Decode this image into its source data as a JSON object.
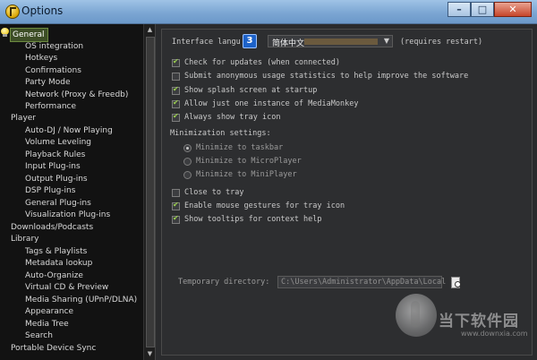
{
  "window": {
    "title": "Options",
    "minimize_label": "–",
    "maximize_label": "□",
    "close_label": "✕"
  },
  "tree": {
    "items": [
      {
        "label": "General",
        "level": 0,
        "selected": true
      },
      {
        "label": "OS integration",
        "level": 1
      },
      {
        "label": "Hotkeys",
        "level": 1
      },
      {
        "label": "Confirmations",
        "level": 1
      },
      {
        "label": "Party Mode",
        "level": 1
      },
      {
        "label": "Network (Proxy & Freedb)",
        "level": 1
      },
      {
        "label": "Performance",
        "level": 1
      },
      {
        "label": "Player",
        "level": 0
      },
      {
        "label": "Auto-DJ / Now Playing",
        "level": 1
      },
      {
        "label": "Volume Leveling",
        "level": 1
      },
      {
        "label": "Playback Rules",
        "level": 1
      },
      {
        "label": "Input Plug-ins",
        "level": 1
      },
      {
        "label": "Output Plug-ins",
        "level": 1
      },
      {
        "label": "DSP Plug-ins",
        "level": 1
      },
      {
        "label": "General Plug-ins",
        "level": 1
      },
      {
        "label": "Visualization Plug-ins",
        "level": 1
      },
      {
        "label": "Downloads/Podcasts",
        "level": 0
      },
      {
        "label": "Library",
        "level": 0
      },
      {
        "label": "Tags & Playlists",
        "level": 1
      },
      {
        "label": "Metadata lookup",
        "level": 1
      },
      {
        "label": "Auto-Organize",
        "level": 1
      },
      {
        "label": "Virtual CD & Preview",
        "level": 1
      },
      {
        "label": "Media Sharing (UPnP/DLNA)",
        "level": 1
      },
      {
        "label": "Appearance",
        "level": 1
      },
      {
        "label": "Media Tree",
        "level": 1
      },
      {
        "label": "Search",
        "level": 1
      },
      {
        "label": "Portable Device Sync",
        "level": 0
      }
    ]
  },
  "general": {
    "interface_language_label": "Interface langu",
    "step_badge": "3",
    "language_value": "简体中文",
    "requires_restart": "(requires restart)",
    "checkboxes": [
      {
        "label": "Check for updates (when connected)",
        "checked": true,
        "dim": false
      },
      {
        "label": "Submit anonymous usage statistics to help improve the software",
        "checked": false,
        "dim": false
      },
      {
        "label": "Show splash screen at startup",
        "checked": true,
        "dim": false
      },
      {
        "label": "Allow just one instance of MediaMonkey",
        "checked": true,
        "dim": false
      },
      {
        "label": "Always show tray icon",
        "checked": true,
        "dim": false
      }
    ],
    "minimization_label": "Minimization settings:",
    "radios": [
      {
        "label": "Minimize to taskbar",
        "selected": true
      },
      {
        "label": "Minimize to MicroPlayer",
        "selected": false
      },
      {
        "label": "Minimize to MiniPlayer",
        "selected": false
      }
    ],
    "checkboxes2": [
      {
        "label": "Close to tray",
        "checked": false
      },
      {
        "label": "Enable mouse gestures for tray icon",
        "checked": true
      },
      {
        "label": "Show tooltips for context help",
        "checked": true
      }
    ],
    "temp_dir_label": "Temporary directory:",
    "temp_dir_value": "C:\\Users\\Administrator\\AppData\\Local"
  },
  "watermark": {
    "text": "当下软件园",
    "url": "www.downxia.com"
  }
}
